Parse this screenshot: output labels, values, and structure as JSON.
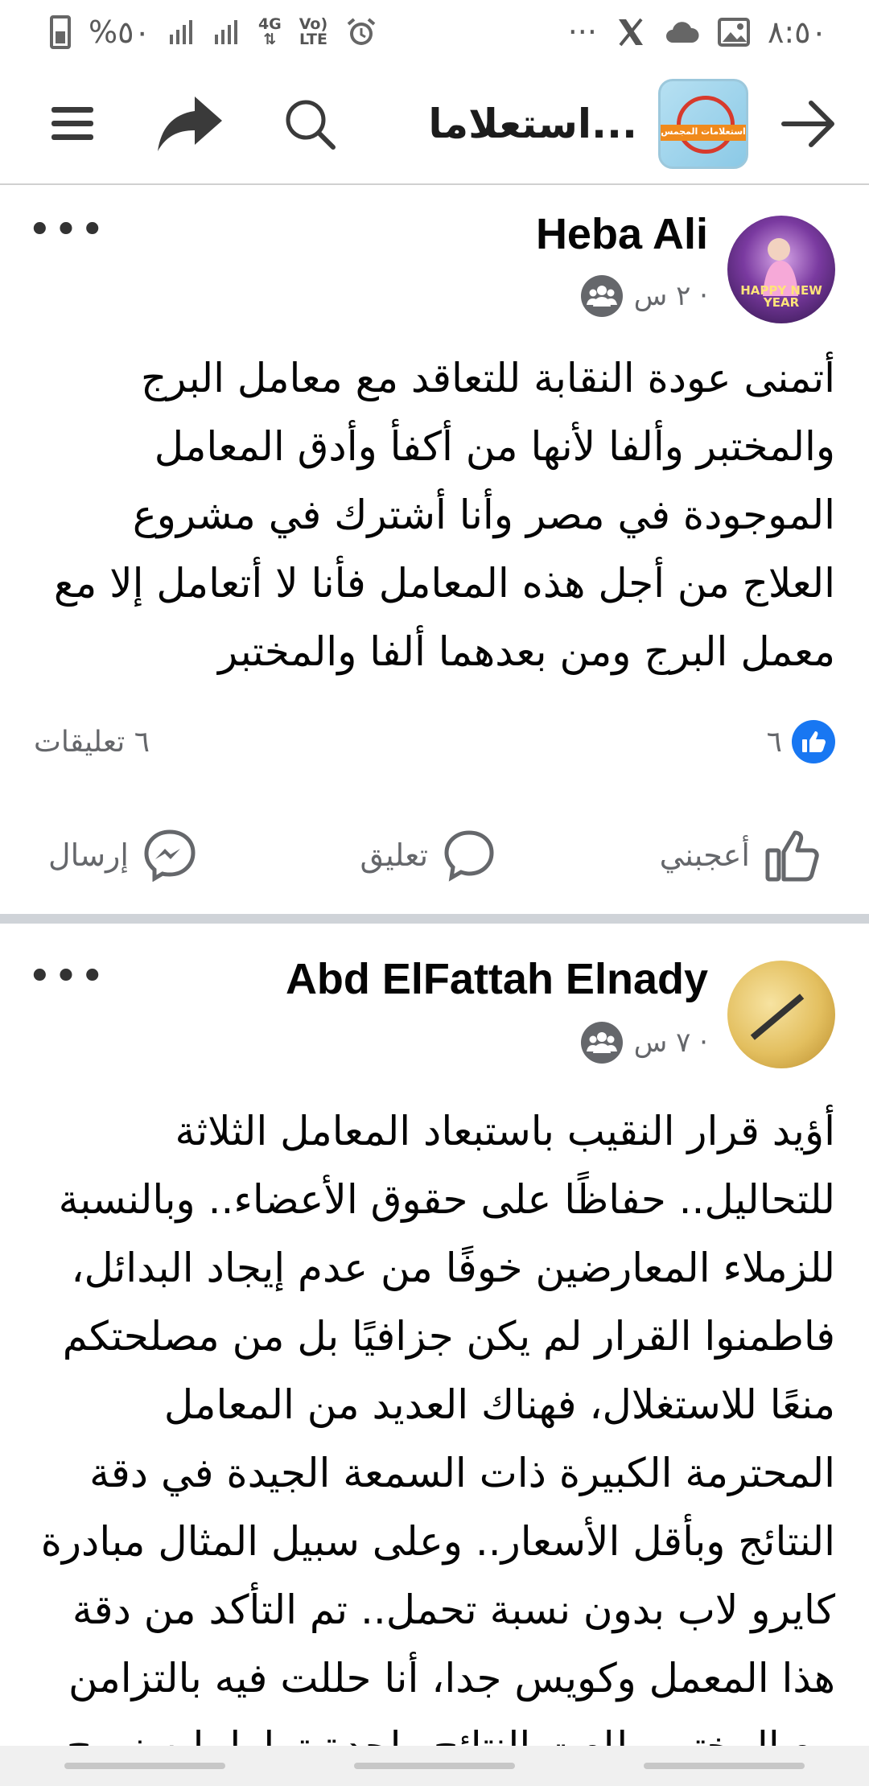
{
  "status_bar": {
    "battery_text": "%٥٠",
    "network_4g": "4G",
    "volte_top": "Vo)",
    "volte_bottom": "LTE",
    "more": "···",
    "time": "٨:٥٠"
  },
  "appbar": {
    "group_title": "استعلاما...",
    "group_logo_text": "استعلامات المجمس",
    "icons": [
      "menu-icon",
      "share-icon",
      "search-icon",
      "arrow-right-icon"
    ]
  },
  "posts": [
    {
      "author": "Heba Ali",
      "time": "٢ س ·",
      "avatar_caption": "HAPPY NEW YEAR",
      "text": "أتمنى عودة النقابة للتعاقد مع معامل البرج والمختبر وألفا لأنها من أكفأ وأدق المعامل الموجودة في مصر وأنا أشترك في مشروع العلاج من أجل هذه المعامل فأنا لا أتعامل إلا مع معمل البرج ومن بعدهما ألفا والمختبر",
      "likes": "٦",
      "comments": "٦ تعليقات",
      "actions": {
        "like": "أعجبني",
        "comment": "تعليق",
        "send": "إرسال"
      }
    },
    {
      "author": "Abd ElFattah Elnady",
      "time": "٧ س ·",
      "text": "أؤيد قرار النقيب باستبعاد المعامل الثلاثة للتحاليل.. حفاظًا على حقوق الأعضاء.. وبالنسبة للزملاء المعارضين خوفًا من عدم إيجاد البدائل، فاطمنوا القرار لم يكن جزافيًا بل من مصلحتكم منعًا للاستغلال، فهناك العديد من المعامل المحترمة الكبيرة ذات السمعة الجيدة في دقة النتائج وبأقل الأسعار.. وعلى سبيل المثال مبادرة كايرو لاب بدون نسبة تحمل.. تم التأكد من دقة هذا المعمل وكويس جدا، أنا حللت فيه بالتزامن مع المختبر طلعت النتائج واحدة تماما. ليه نروح"
    }
  ],
  "colors": {
    "accent": "#1877f2",
    "muted": "#65676b",
    "separator": "#cfd3d8"
  }
}
